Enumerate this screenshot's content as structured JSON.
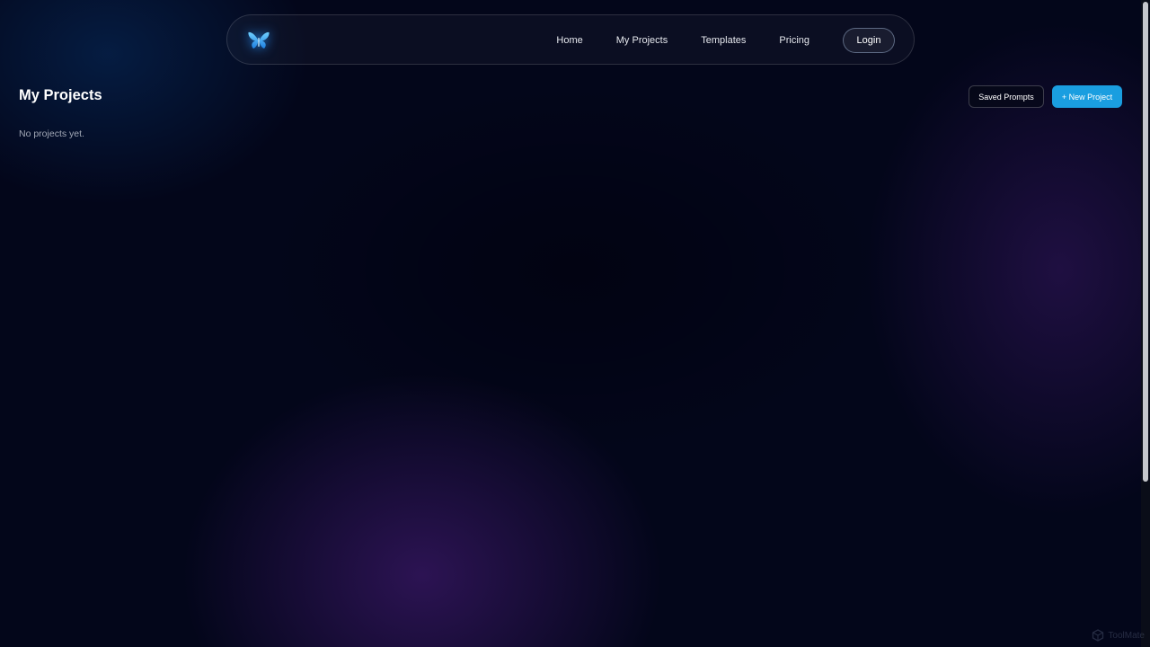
{
  "navbar": {
    "logo_icon": "butterfly-icon",
    "links": [
      {
        "label": "Home"
      },
      {
        "label": "My Projects"
      },
      {
        "label": "Templates"
      },
      {
        "label": "Pricing"
      }
    ],
    "login_label": "Login"
  },
  "main": {
    "title": "My Projects",
    "saved_prompts_label": "Saved Prompts",
    "new_project_label": "+ New Project",
    "empty_message": "No projects yet."
  },
  "watermark": {
    "icon": "cube-icon",
    "text": "ToolMate"
  },
  "colors": {
    "background": "#03061a",
    "accent": "#1a9ee0",
    "glow_purple": "#4e1e82",
    "muted_text": "#a2a8b6"
  }
}
